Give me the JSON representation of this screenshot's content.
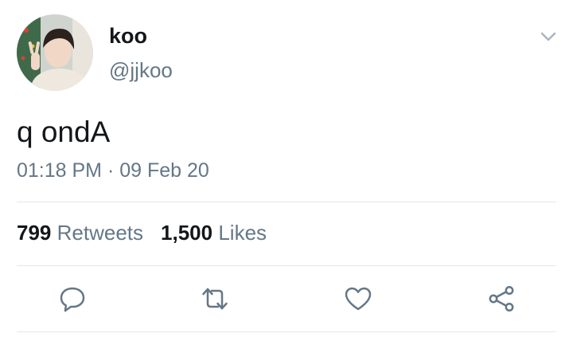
{
  "tweet": {
    "author": {
      "display_name": "koo",
      "handle": "@jjkoo"
    },
    "text": "q ondA",
    "time": "01:18 PM",
    "separator": "·",
    "date": "09 Feb 20",
    "stats": {
      "retweets_count": "799",
      "retweets_label": "Retweets",
      "likes_count": "1,500",
      "likes_label": "Likes"
    },
    "actions": [
      "reply-icon",
      "retweet-icon",
      "like-icon",
      "share-icon"
    ],
    "more_icon": "chevron-down-icon"
  },
  "colors": {
    "text_primary": "#14171a",
    "text_secondary": "#657786",
    "divider": "#e1e8ed",
    "icon": "#657786"
  }
}
